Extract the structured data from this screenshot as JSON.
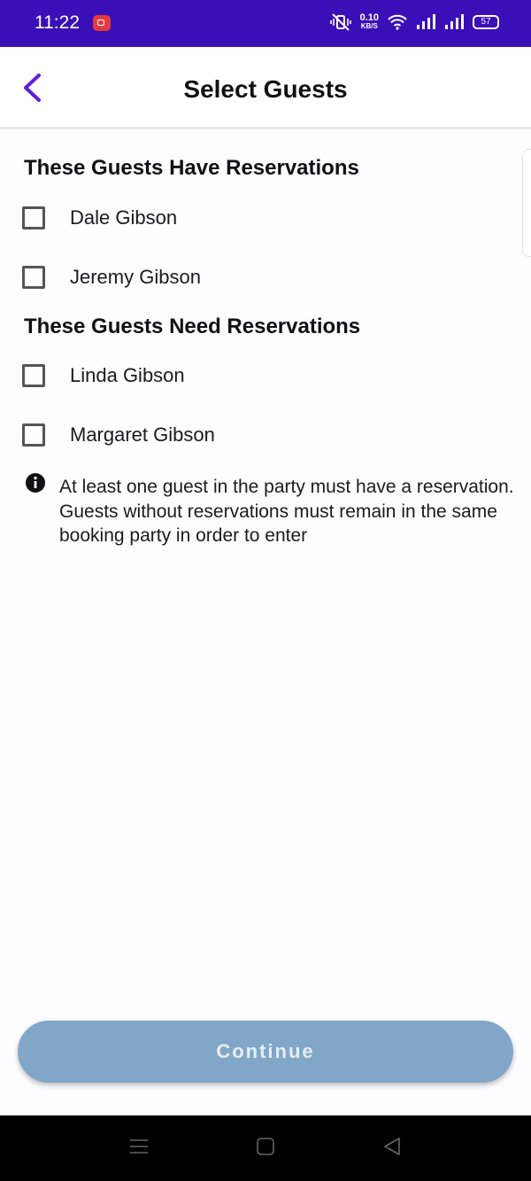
{
  "status": {
    "time": "11:22",
    "net_speed_value": "0.10",
    "net_speed_unit": "KB/S",
    "battery": "57"
  },
  "appbar": {
    "title": "Select Guests",
    "back_icon": "chevron-left-icon"
  },
  "sections": [
    {
      "heading": "These Guests Have Reservations",
      "guests": [
        {
          "name": "Dale Gibson",
          "checked": false
        },
        {
          "name": "Jeremy Gibson",
          "checked": false
        }
      ]
    },
    {
      "heading": "These Guests Need Reservations",
      "guests": [
        {
          "name": "Linda Gibson",
          "checked": false
        },
        {
          "name": "Margaret Gibson",
          "checked": false
        }
      ]
    }
  ],
  "info": {
    "icon": "info-icon",
    "text": "At least one guest in the party must have a reservation. Guests without reservations must remain in the same booking party in order to enter"
  },
  "continue_button": {
    "label": "Continue",
    "enabled": false
  },
  "colors": {
    "status_bar": "#3a0fb8",
    "accent": "#5b1fd6",
    "button_disabled": "#82a6c8"
  }
}
